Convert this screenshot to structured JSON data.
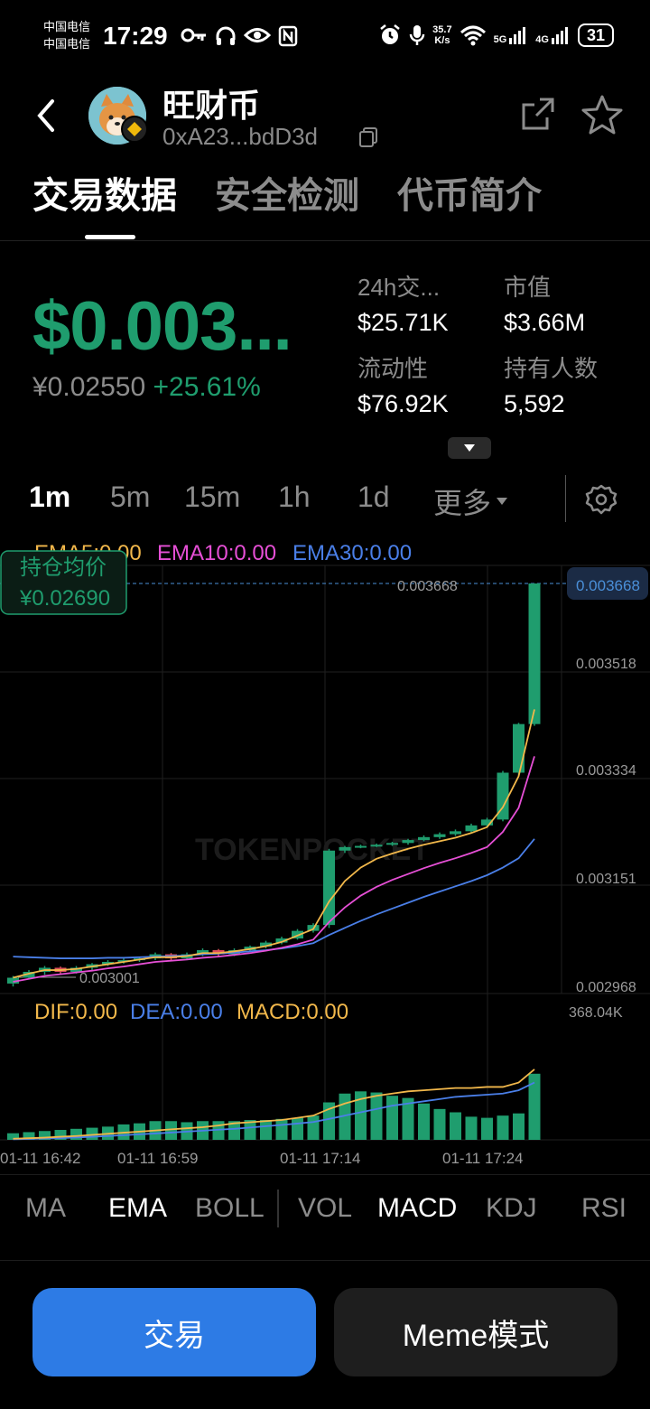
{
  "status_bar": {
    "carrier1": "中国电信",
    "carrier2": "中国电信",
    "time": "17:29",
    "net_speed_value": "35.7",
    "net_speed_unit": "K/s",
    "signal1": "5G",
    "signal2": "4G",
    "battery": "31"
  },
  "header": {
    "token_name": "旺财币",
    "token_address": "0xA23...bdD3d"
  },
  "tabs": [
    {
      "label": "交易数据",
      "active": true
    },
    {
      "label": "安全检测",
      "active": false
    },
    {
      "label": "代币简介",
      "active": false
    }
  ],
  "price": {
    "usd": "$0.003...",
    "cny": "¥0.02550",
    "change": "+25.61%"
  },
  "stats": {
    "vol_label": "24h交...",
    "vol_value": "$25.71K",
    "mcap_label": "市值",
    "mcap_value": "$3.66M",
    "liq_label": "流动性",
    "liq_value": "$76.92K",
    "holders_label": "持有人数",
    "holders_value": "5,592"
  },
  "intervals": [
    {
      "label": "1m",
      "active": true
    },
    {
      "label": "5m",
      "active": false
    },
    {
      "label": "15m",
      "active": false
    },
    {
      "label": "1h",
      "active": false
    },
    {
      "label": "1d",
      "active": false
    },
    {
      "label": "更多",
      "active": false
    }
  ],
  "chart": {
    "ema_legend": {
      "ema5": "EMA5:0.00",
      "ema10": "EMA10:0.00",
      "ema30": "EMA30:0.00"
    },
    "macd_legend": {
      "dif": "DIF:0.00",
      "dea": "DEA:0.00",
      "macd": "MACD:0.00"
    },
    "avg_cost_label": "持仓均价",
    "avg_cost_value": "¥0.02690",
    "current_price_tag": "0.003668",
    "current_price_line_label": "0.003668",
    "low_marker": "0.003001",
    "y_ticks": [
      "0.003518",
      "0.003334",
      "0.003151",
      "0.002968"
    ],
    "vol_max": "368.04K",
    "x_ticks": [
      "01-11 16:42",
      "01-11 16:59",
      "01-11 17:14",
      "01-11 17:24"
    ],
    "watermark": "TOKENPOCKET",
    "colors": {
      "up": "#1f9d6e",
      "down": "#e0505a",
      "ema5": "#f2b84b",
      "ema10": "#e64fd6",
      "ema30": "#4a7fe8",
      "dif": "#f2b84b",
      "dea": "#4a7fe8"
    }
  },
  "chart_data": {
    "type": "candlestick",
    "price_ylim": [
      0.002968,
      0.003668
    ],
    "candles": [
      {
        "o": 0.002985,
        "c": 0.002995,
        "h": 0.002998,
        "l": 0.00298
      },
      {
        "o": 0.002995,
        "c": 0.003005,
        "h": 0.003008,
        "l": 0.002992
      },
      {
        "o": 0.003005,
        "c": 0.003012,
        "h": 0.003015,
        "l": 0.003
      },
      {
        "o": 0.003012,
        "c": 0.003005,
        "h": 0.003014,
        "l": 0.003001
      },
      {
        "o": 0.003005,
        "c": 0.003012,
        "h": 0.003015,
        "l": 0.003002
      },
      {
        "o": 0.003012,
        "c": 0.003018,
        "h": 0.00302,
        "l": 0.003008
      },
      {
        "o": 0.003018,
        "c": 0.003022,
        "h": 0.003025,
        "l": 0.003015
      },
      {
        "o": 0.003022,
        "c": 0.003025,
        "h": 0.003028,
        "l": 0.003019
      },
      {
        "o": 0.003025,
        "c": 0.003028,
        "h": 0.00303,
        "l": 0.003022
      },
      {
        "o": 0.003028,
        "c": 0.003035,
        "h": 0.003038,
        "l": 0.003025
      },
      {
        "o": 0.003035,
        "c": 0.003028,
        "h": 0.003037,
        "l": 0.003025
      },
      {
        "o": 0.003028,
        "c": 0.003035,
        "h": 0.003038,
        "l": 0.003025
      },
      {
        "o": 0.003035,
        "c": 0.003042,
        "h": 0.003045,
        "l": 0.003032
      },
      {
        "o": 0.003042,
        "c": 0.003035,
        "h": 0.003044,
        "l": 0.003032
      },
      {
        "o": 0.003035,
        "c": 0.003042,
        "h": 0.003045,
        "l": 0.003032
      },
      {
        "o": 0.003042,
        "c": 0.003048,
        "h": 0.00305,
        "l": 0.00304
      },
      {
        "o": 0.003048,
        "c": 0.003055,
        "h": 0.003058,
        "l": 0.003045
      },
      {
        "o": 0.003055,
        "c": 0.003062,
        "h": 0.003065,
        "l": 0.003052
      },
      {
        "o": 0.003062,
        "c": 0.003075,
        "h": 0.003078,
        "l": 0.00306
      },
      {
        "o": 0.003075,
        "c": 0.003085,
        "h": 0.003088,
        "l": 0.003072
      },
      {
        "o": 0.003085,
        "c": 0.003212,
        "h": 0.003215,
        "l": 0.00308
      },
      {
        "o": 0.003212,
        "c": 0.003218,
        "h": 0.00322,
        "l": 0.003208
      },
      {
        "o": 0.003218,
        "c": 0.00322,
        "h": 0.003222,
        "l": 0.003216
      },
      {
        "o": 0.00322,
        "c": 0.003222,
        "h": 0.003224,
        "l": 0.003218
      },
      {
        "o": 0.003222,
        "c": 0.003225,
        "h": 0.003227,
        "l": 0.00322
      },
      {
        "o": 0.003225,
        "c": 0.00323,
        "h": 0.003232,
        "l": 0.003222
      },
      {
        "o": 0.00323,
        "c": 0.003235,
        "h": 0.003238,
        "l": 0.003228
      },
      {
        "o": 0.003235,
        "c": 0.00324,
        "h": 0.003243,
        "l": 0.003232
      },
      {
        "o": 0.00324,
        "c": 0.003245,
        "h": 0.003248,
        "l": 0.003237
      },
      {
        "o": 0.003245,
        "c": 0.003255,
        "h": 0.003258,
        "l": 0.003242
      },
      {
        "o": 0.003255,
        "c": 0.003265,
        "h": 0.003268,
        "l": 0.003252
      },
      {
        "o": 0.003265,
        "c": 0.003345,
        "h": 0.003348,
        "l": 0.003262
      },
      {
        "o": 0.003345,
        "c": 0.003428,
        "h": 0.00343,
        "l": 0.00334
      },
      {
        "o": 0.003428,
        "c": 0.003668,
        "h": 0.003668,
        "l": 0.003425
      }
    ],
    "ema5": [
      0.002995,
      0.003002,
      0.003008,
      0.003008,
      0.00301,
      0.003014,
      0.003018,
      0.003022,
      0.003026,
      0.00303,
      0.00303,
      0.003032,
      0.003037,
      0.003037,
      0.00304,
      0.003044,
      0.003049,
      0.003056,
      0.003067,
      0.003078,
      0.003125,
      0.00316,
      0.003183,
      0.003198,
      0.003207,
      0.003215,
      0.003222,
      0.003228,
      0.003234,
      0.003242,
      0.003252,
      0.003286,
      0.003339,
      0.003453
    ],
    "ema10": [
      0.002988,
      0.002993,
      0.002998,
      0.003001,
      0.003004,
      0.003007,
      0.003011,
      0.003014,
      0.003018,
      0.003022,
      0.003024,
      0.003026,
      0.003029,
      0.003031,
      0.003034,
      0.003037,
      0.003041,
      0.003046,
      0.003052,
      0.00306,
      0.00309,
      0.003115,
      0.003135,
      0.00315,
      0.003162,
      0.003172,
      0.003182,
      0.003191,
      0.003199,
      0.003208,
      0.003218,
      0.003244,
      0.003285,
      0.003373
    ],
    "ema30": [
      0.003031,
      0.00303,
      0.003029,
      0.003028,
      0.003028,
      0.003028,
      0.003029,
      0.003029,
      0.00303,
      0.003031,
      0.003032,
      0.003033,
      0.003035,
      0.003036,
      0.003038,
      0.00304,
      0.003042,
      0.003045,
      0.003049,
      0.003054,
      0.003068,
      0.00308,
      0.003092,
      0.003103,
      0.003113,
      0.003123,
      0.003133,
      0.003142,
      0.003151,
      0.00316,
      0.00317,
      0.003183,
      0.003199,
      0.003232
    ],
    "volumes": [
      0.06,
      0.07,
      0.08,
      0.09,
      0.1,
      0.11,
      0.12,
      0.14,
      0.15,
      0.17,
      0.17,
      0.16,
      0.17,
      0.17,
      0.17,
      0.18,
      0.18,
      0.19,
      0.2,
      0.22,
      0.34,
      0.42,
      0.44,
      0.43,
      0.4,
      0.38,
      0.33,
      0.28,
      0.25,
      0.21,
      0.2,
      0.22,
      0.24,
      0.6
    ],
    "dif": [
      0.01,
      0.015,
      0.02,
      0.028,
      0.035,
      0.045,
      0.055,
      0.065,
      0.075,
      0.085,
      0.095,
      0.105,
      0.115,
      0.13,
      0.15,
      0.16,
      0.17,
      0.18,
      0.2,
      0.22,
      0.28,
      0.33,
      0.37,
      0.4,
      0.42,
      0.44,
      0.45,
      0.46,
      0.47,
      0.47,
      0.48,
      0.48,
      0.52,
      0.64
    ],
    "dea": [
      0.005,
      0.008,
      0.012,
      0.016,
      0.022,
      0.028,
      0.035,
      0.042,
      0.05,
      0.058,
      0.066,
      0.075,
      0.083,
      0.092,
      0.1,
      0.112,
      0.124,
      0.135,
      0.148,
      0.162,
      0.19,
      0.22,
      0.25,
      0.28,
      0.31,
      0.33,
      0.35,
      0.37,
      0.39,
      0.4,
      0.41,
      0.42,
      0.45,
      0.52
    ],
    "x_ticks": [
      "01-11 16:42",
      "01-11 16:59",
      "01-11 17:14",
      "01-11 17:24"
    ],
    "y_ticks": [
      0.003518,
      0.003334,
      0.003151,
      0.002968
    ],
    "vol_max_label": "368.04K"
  },
  "indicators": [
    {
      "label": "MA",
      "active": false
    },
    {
      "label": "EMA",
      "active": true
    },
    {
      "label": "BOLL",
      "active": false
    },
    {
      "label": "VOL",
      "active": false
    },
    {
      "label": "MACD",
      "active": true
    },
    {
      "label": "KDJ",
      "active": false
    },
    {
      "label": "RSI",
      "active": false
    }
  ],
  "buttons": {
    "trade": "交易",
    "meme": "Meme模式"
  }
}
